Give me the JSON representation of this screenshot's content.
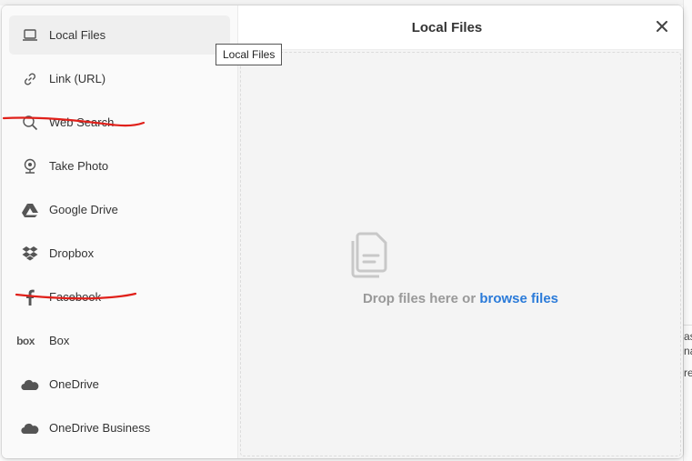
{
  "dialog": {
    "title": "Local Files",
    "close_label": "×"
  },
  "sidebar": {
    "items": [
      {
        "label": "Local Files",
        "icon": "laptop-icon",
        "active": true
      },
      {
        "label": "Link (URL)",
        "icon": "link-icon"
      },
      {
        "label": "Web Search",
        "icon": "search-icon",
        "struck": true
      },
      {
        "label": "Take Photo",
        "icon": "webcam-icon"
      },
      {
        "label": "Google Drive",
        "icon": "google-drive-icon"
      },
      {
        "label": "Dropbox",
        "icon": "dropbox-icon"
      },
      {
        "label": "Facebook",
        "icon": "facebook-icon",
        "struck": true
      },
      {
        "label": "Box",
        "icon": "box-icon",
        "icon_text": "box"
      },
      {
        "label": "OneDrive",
        "icon": "cloud-icon"
      },
      {
        "label": "OneDrive Business",
        "icon": "cloud-icon"
      }
    ]
  },
  "dropzone": {
    "prompt": "Drop files here or",
    "link": "browse files",
    "icon": "files-icon"
  },
  "tooltip": {
    "text": "Local Files"
  },
  "background": {
    "frag1": "as",
    "frag2": "na",
    "frag3": "re"
  },
  "colors": {
    "link": "#2b7bd9",
    "annotation_red": "#e0201a"
  }
}
